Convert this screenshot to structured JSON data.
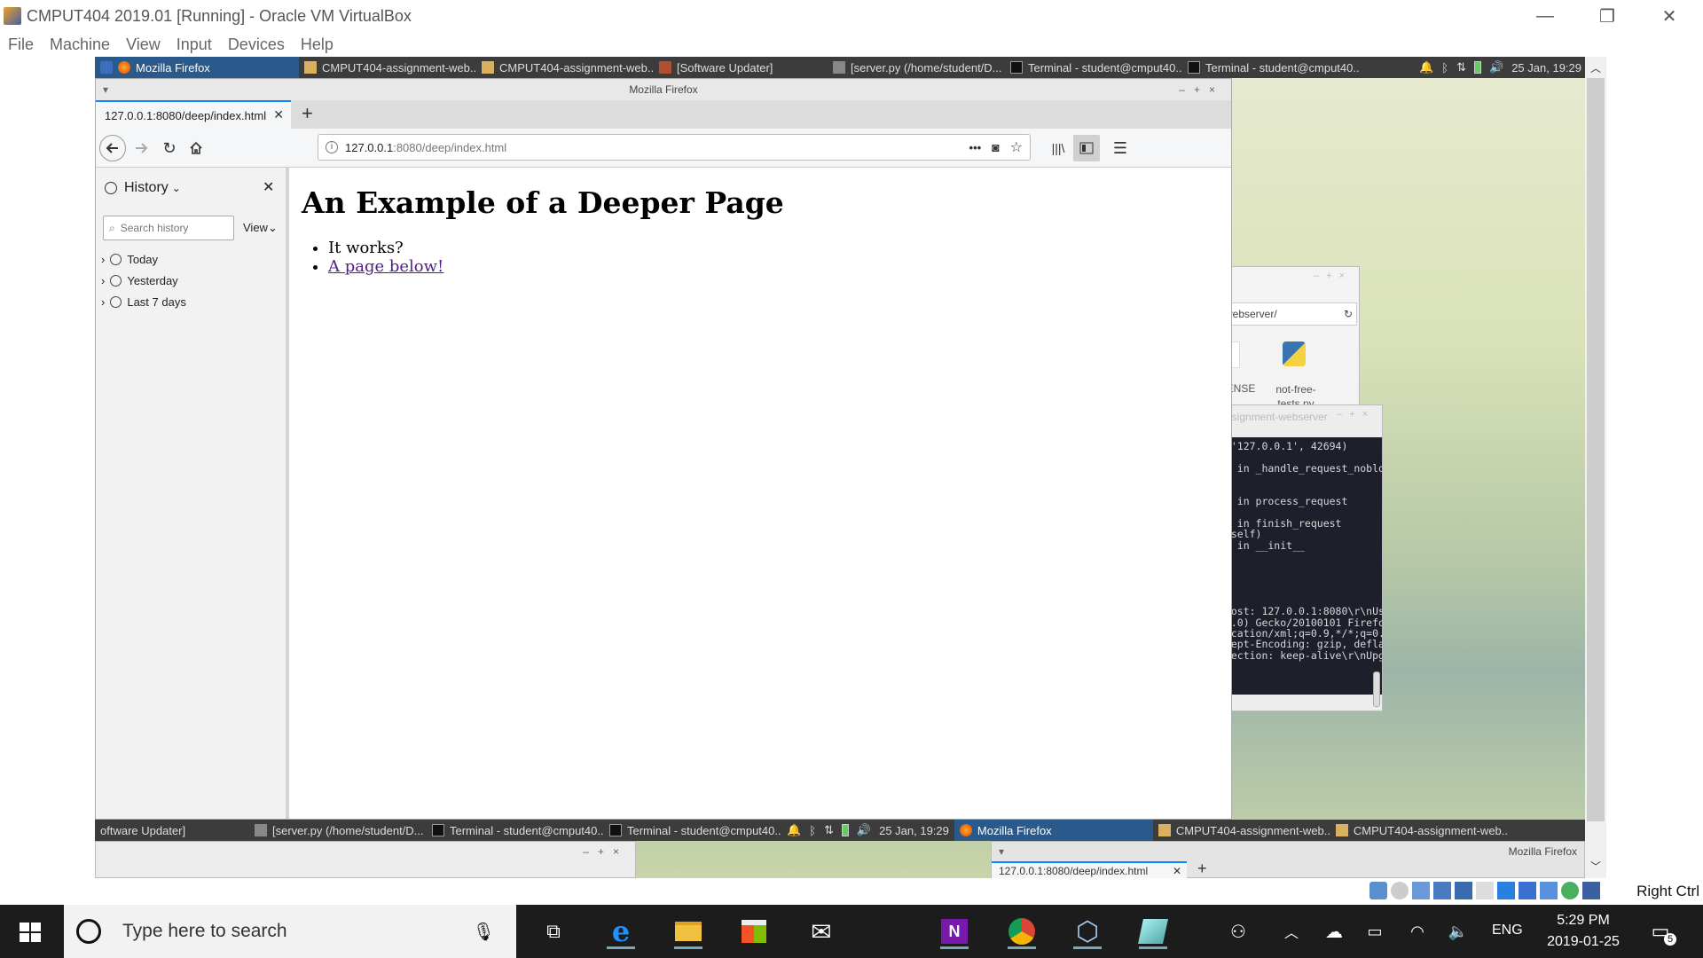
{
  "host": {
    "title": "CMPUT404 2019.01 [Running] - Oracle VM VirtualBox",
    "menu": [
      "File",
      "Machine",
      "View",
      "Input",
      "Devices",
      "Help"
    ],
    "status_right": "Right Ctrl"
  },
  "guest_panel": {
    "tasks": [
      "Mozilla Firefox",
      "CMPUT404-assignment-web...",
      "CMPUT404-assignment-web...",
      "[Software Updater]",
      "[server.py (/home/student/D...",
      "Terminal - student@cmput40...",
      "Terminal - student@cmput40..."
    ],
    "clock": "25 Jan, 19:29"
  },
  "firefox": {
    "window_title": "Mozilla Firefox",
    "tab_title": "127.0.0.1:8080/deep/index.html",
    "url_host": "127.0.0.1",
    "url_rest": ":8080/deep/index.html",
    "sidebar": {
      "title": "History",
      "search_placeholder": "Search history",
      "view_label": "View",
      "groups": [
        "Today",
        "Yesterday",
        "Last 7 days"
      ]
    },
    "page": {
      "heading": "An Example of a Deeper Page",
      "items": [
        "It works?",
        "A page below!"
      ]
    }
  },
  "file_manager": {
    "path_fragment": "-webserver/",
    "files": [
      "CENSE",
      "not-free-tests.py"
    ]
  },
  "terminal": {
    "title_fragment": "assignment-webserver",
    "lines": [
      " ('127.0.0.1', 42694)",
      "",
      "7, in _handle_request_nobloc",
      "",
      "",
      "8, in process_request",
      "",
      "1, in finish_request",
      ", self)",
      "1, in __init__",
      "",
      "",
      "",
      "",
      "",
      "nHost: 127.0.0.1:8080\\r\\nUse",
      "64.0) Gecko/20100101 Firefox",
      "lication/xml;q=0.9,*/*;q=0.8",
      "ccept-Encoding: gzip, deflat",
      "nnection: keep-alive\\r\\nUpgr"
    ]
  },
  "bottom_panel": {
    "tasks": [
      "oftware Updater]",
      "[server.py (/home/student/D...",
      "Terminal - student@cmput40...",
      "Terminal - student@cmput40..."
    ],
    "clock": "25 Jan, 19:29",
    "tasks2": [
      "Mozilla Firefox",
      "CMPUT404-assignment-web...",
      "CMPUT404-assignment-web..."
    ],
    "right_title": "Mozilla Firefox",
    "peek_tab": "127.0.0.1:8080/deep/index.html"
  },
  "windows_taskbar": {
    "search_placeholder": "Type here to search",
    "lang": "ENG",
    "time": "5:29 PM",
    "date": "2019-01-25",
    "notifications": "5"
  }
}
